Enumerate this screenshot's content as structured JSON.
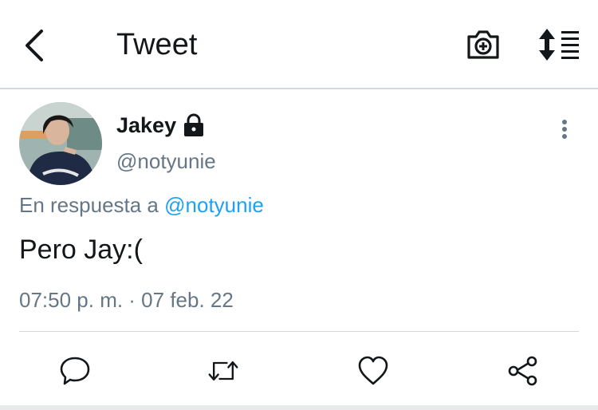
{
  "header": {
    "title": "Tweet",
    "back_icon": "chevron-left-icon",
    "camera_icon": "camera-plus-icon",
    "sort_icon": "sort-list-icon"
  },
  "tweet": {
    "author_name": "Jakey",
    "protected_icon": "lock-icon",
    "handle": "@notyunie",
    "reply_prefix": "En respuesta a",
    "reply_to": "@notyunie",
    "text": "Pero Jay:(",
    "timestamp": "07:50 p. m. · 07 feb. 22"
  },
  "actions": {
    "reply_icon": "reply-icon",
    "retweet_icon": "retweet-icon",
    "like_icon": "heart-icon",
    "share_icon": "share-icon"
  },
  "colors": {
    "accent": "#1da1f2",
    "secondary_text": "#657786",
    "divider": "#d6d9dc",
    "icon": "#14171a"
  }
}
